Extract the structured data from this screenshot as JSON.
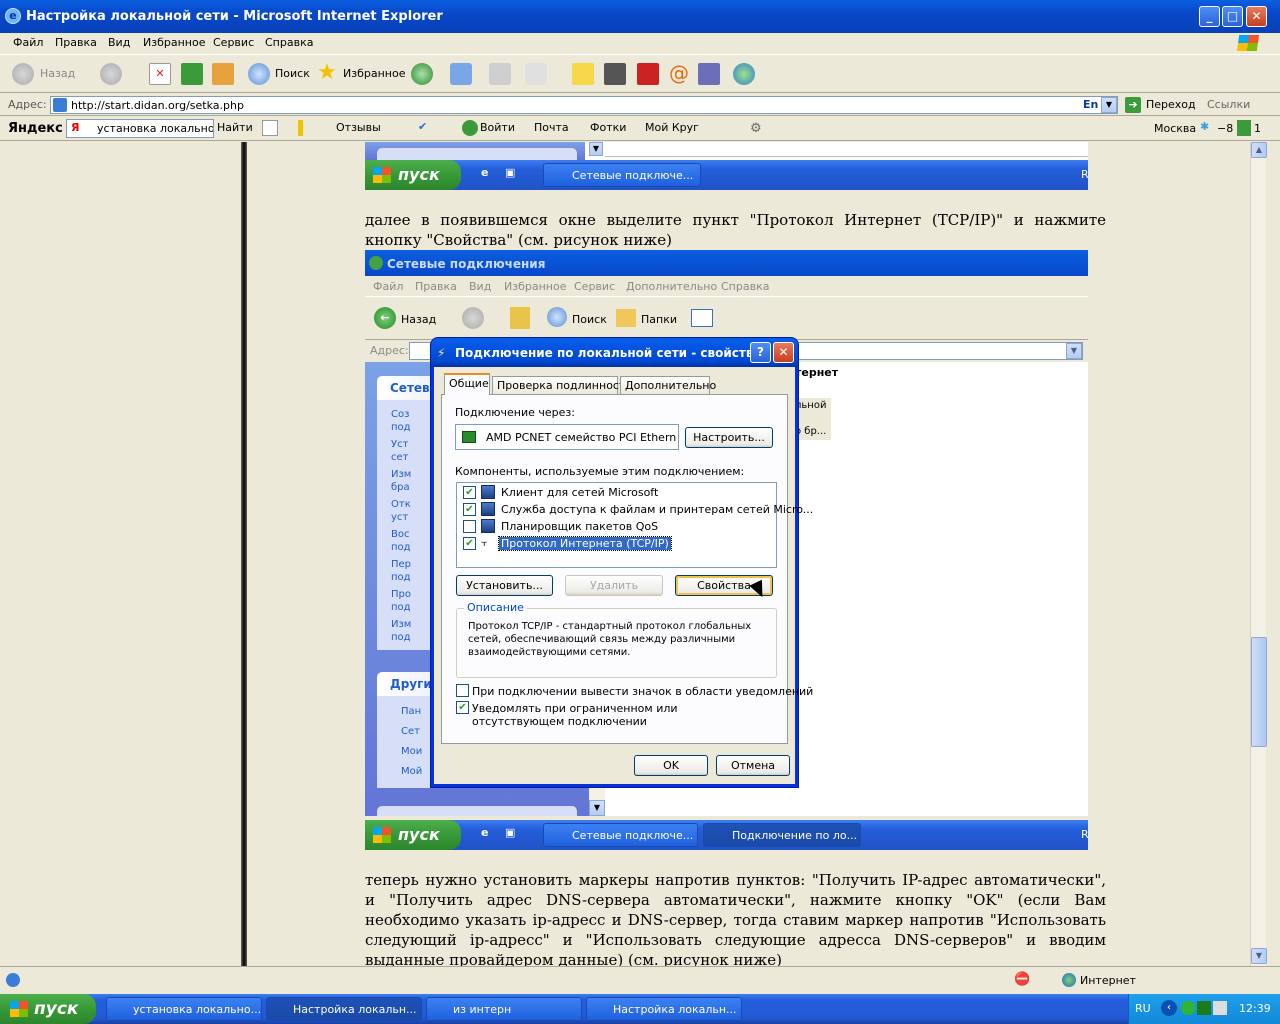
{
  "window": {
    "title": "Настройка локальной сети - Microsoft Internet Explorer",
    "min": "_",
    "max": "□",
    "close": "✕"
  },
  "menu": [
    "Файл",
    "Правка",
    "Вид",
    "Избранное",
    "Сервис",
    "Справка"
  ],
  "toolbar": {
    "back": "Назад",
    "search": "Поиск",
    "favorites": "Избранное"
  },
  "address": {
    "label": "Адрес:",
    "url": "http://start.didan.org/setka.php",
    "lang": "En",
    "go": "Переход",
    "links": "Ссылки"
  },
  "yandex": {
    "logo": "Яндекс",
    "query": "установка локальной с",
    "find": "Найти",
    "reviews": "Отзывы",
    "login": "Войти",
    "mail": "Почта",
    "photos": "Фотки",
    "circle": "Мой Круг",
    "city": "Москва",
    "temp": "−8",
    "num": "1"
  },
  "page": {
    "para1": "далее в появившемся окне выделите пункт \"Протокол Интернет (TCP/IP)\" и нажмите кнопку \"Свойства\" (см. рисунок ниже)",
    "para2": "теперь нужно установить маркеры напротив пунктов: \"Получить IP-адрес автоматически\", и \"Получить адрес DNS-сервера автоматически\", нажмите кнопку \"OK\" (если Вам необходимо указать ip-адресс и DNS-сервер, тогда ставим маркер напротив \"Использовать следующий ip-адресс\" и \"Использовать следующие адресса DNS-серверов\" и вводим выданные провайдером данные) (см. рисунок ниже)"
  },
  "shot_top": {
    "start": "пуск",
    "task1": "Сетевые подключе...",
    "r": "R"
  },
  "netconn": {
    "title": "Сетевые подключения",
    "menu": [
      "Файл",
      "Правка",
      "Вид",
      "Избранное",
      "Сервис",
      "Дополнительно",
      "Справка"
    ],
    "back": "Назад",
    "search": "Поиск",
    "folders": "Папки",
    "addr": "Адрес:",
    "side_head": "Сетев",
    "side_items": [
      "Соз под",
      "Уст сет",
      "Изм бра",
      "Отк уст",
      "Вос под",
      "Пер под",
      "Про под",
      "Изм под"
    ],
    "other_head": "Други",
    "other_items": [
      "Пан",
      "Сет",
      "Мои",
      "Мой"
    ],
    "right_head": "тернет",
    "right_items": [
      "льной",
      "о бр..."
    ],
    "start": "пуск",
    "task1": "Сетевые подключе...",
    "task2": "Подключение по ло...",
    "r": "R"
  },
  "dialog": {
    "title": "Подключение по локальной сети - свойства",
    "help": "?",
    "close": "✕",
    "tabs": [
      "Общие",
      "Проверка подлинности",
      "Дополнительно"
    ],
    "connect_via": "Подключение через:",
    "adapter": "AMD PCNET семейство PCI Ethern",
    "configure": "Настроить...",
    "components_label": "Компоненты, используемые этим подключением:",
    "components": [
      {
        "label": "Клиент для сетей Microsoft",
        "checked": "✔"
      },
      {
        "label": "Служба доступа к файлам и принтерам сетей Micro...",
        "checked": "✔"
      },
      {
        "label": "Планировщик пакетов QoS",
        "checked": ""
      },
      {
        "label": "Протокол Интернета (TCP/IP)",
        "checked": "✔"
      }
    ],
    "install": "Установить...",
    "remove": "Удалить",
    "properties": "Свойства",
    "desc_label": "Описание",
    "desc": "Протокол TCP/IP - стандартный протокол глобальных сетей, обеспечивающий связь между различными взаимодействующими сетями.",
    "notify_icon": "При подключении вывести значок в области уведомлений",
    "notify_limited": "Уведомлять при ограниченном или отсутствующем подключении",
    "notify_limited_checked": "✔",
    "ok": "OK",
    "cancel": "Отмена"
  },
  "statusbar": {
    "zone": "Интернет"
  },
  "taskbar": {
    "start": "пуск",
    "tasks": [
      "установка локально...",
      "Настройка локальн...",
      "из интерн",
      "Настройка локальн..."
    ],
    "lang": "RU",
    "time": "12:39"
  }
}
